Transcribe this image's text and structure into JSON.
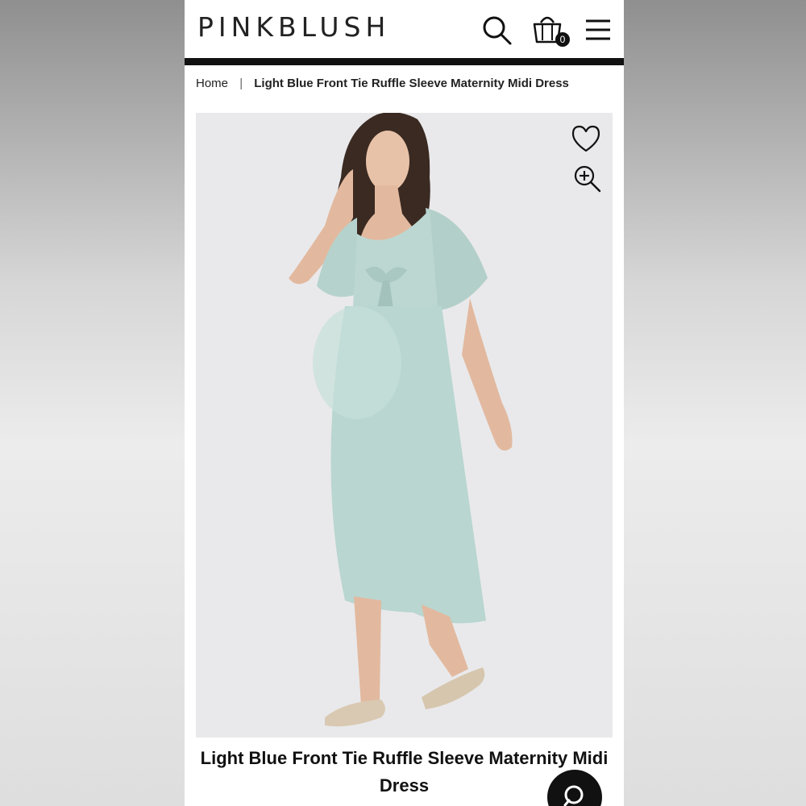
{
  "header": {
    "logo": "PINKBLUSH",
    "cart_count": "0",
    "icons": [
      "search-icon",
      "shopping-bag-icon",
      "hamburger-menu-icon"
    ]
  },
  "breadcrumb": {
    "home": "Home",
    "separator": "|",
    "current": "Light Blue Front Tie Ruffle Sleeve Maternity Midi Dress"
  },
  "product": {
    "image_icons": [
      "heart-icon",
      "zoom-in-icon"
    ],
    "title": "Light Blue Front Tie Ruffle Sleeve Maternity Midi Dress"
  },
  "colors": {
    "header_rule": "#111111",
    "dress": "#b9d6d0",
    "photo_bg": "#e9e9eb"
  }
}
